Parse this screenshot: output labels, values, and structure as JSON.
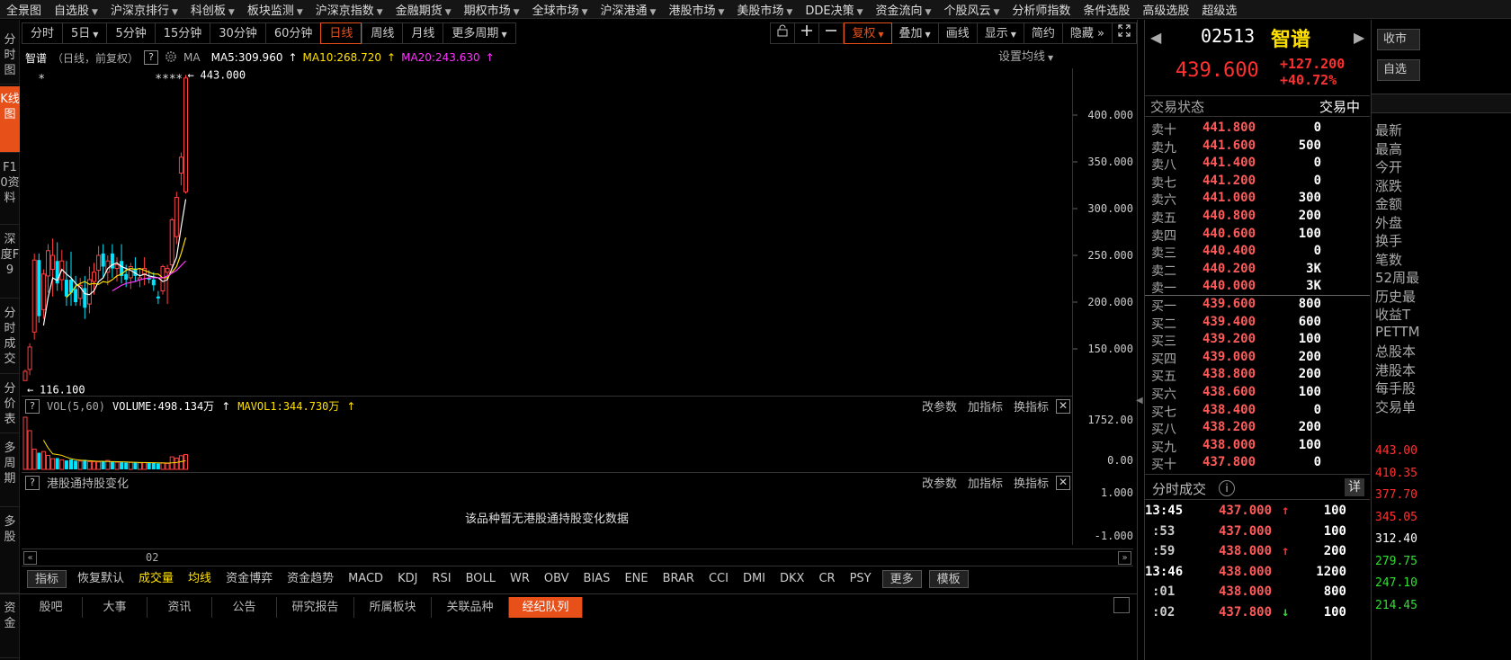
{
  "top_menu": {
    "items": [
      {
        "label": "全景图",
        "dropdown": false
      },
      {
        "label": "自选股",
        "dropdown": true
      },
      {
        "label": "沪深京排行",
        "dropdown": true
      },
      {
        "label": "科创板",
        "dropdown": true
      },
      {
        "label": "板块监测",
        "dropdown": true
      },
      {
        "label": "沪深京指数",
        "dropdown": true
      },
      {
        "label": "金融期货",
        "dropdown": true
      },
      {
        "label": "期权市场",
        "dropdown": true
      },
      {
        "label": "全球市场",
        "dropdown": true
      },
      {
        "label": "沪深港通",
        "dropdown": true
      },
      {
        "label": "港股市场",
        "dropdown": true
      },
      {
        "label": "美股市场",
        "dropdown": true
      },
      {
        "label": "DDE决策",
        "dropdown": true
      },
      {
        "label": "资金流向",
        "dropdown": true
      },
      {
        "label": "个股风云",
        "dropdown": true
      },
      {
        "label": "分析师指数",
        "dropdown": false
      },
      {
        "label": "条件选股",
        "dropdown": false
      },
      {
        "label": "高级选股",
        "dropdown": false
      },
      {
        "label": "超级选",
        "dropdown": false
      }
    ]
  },
  "sidebar": {
    "items": [
      {
        "label": "分时图",
        "active": false
      },
      {
        "label": "K线图",
        "active": true
      },
      {
        "label": "F10资料",
        "active": false
      },
      {
        "label": "深度F9",
        "active": false
      },
      {
        "label": "分时成交",
        "active": false
      },
      {
        "label": "分价表",
        "active": false
      },
      {
        "label": "多周期",
        "active": false
      },
      {
        "label": "多股",
        "active": false
      },
      {
        "label": "资金",
        "active": false
      }
    ]
  },
  "period_toolbar": {
    "buttons": [
      {
        "label": "分时",
        "active": false,
        "dropdown": false
      },
      {
        "label": "5日",
        "active": false,
        "dropdown": true
      },
      {
        "label": "5分钟",
        "active": false,
        "dropdown": false
      },
      {
        "label": "15分钟",
        "active": false,
        "dropdown": false
      },
      {
        "label": "30分钟",
        "active": false,
        "dropdown": false
      },
      {
        "label": "60分钟",
        "active": false,
        "dropdown": false
      },
      {
        "label": "日线",
        "active": true,
        "dropdown": false
      },
      {
        "label": "周线",
        "active": false,
        "dropdown": false
      },
      {
        "label": "月线",
        "active": false,
        "dropdown": false
      },
      {
        "label": "更多周期",
        "active": false,
        "dropdown": true
      }
    ],
    "right_buttons": [
      {
        "label": "复权",
        "active": true,
        "dropdown": true
      },
      {
        "label": "叠加",
        "active": false,
        "dropdown": true
      },
      {
        "label": "画线",
        "active": false,
        "dropdown": false
      },
      {
        "label": "显示",
        "active": false,
        "dropdown": true
      },
      {
        "label": "简约",
        "active": false,
        "dropdown": false
      },
      {
        "label": "隐藏",
        "active": false,
        "dropdown": false
      }
    ],
    "icons": [
      "lock-icon",
      "plus-icon",
      "minus-icon",
      "fullscreen-icon",
      "double-chevron-right-icon"
    ]
  },
  "kline_header": {
    "stock_name": "智谱",
    "mode": "（日线，前复权）",
    "ma_label": "MA",
    "ma5": "MA5:309.960",
    "ma10": "MA10:268.720",
    "ma20": "MA20:243.630",
    "settings": "设置均线",
    "ma5_color": "#ffffff",
    "ma10_color": "#ffe000",
    "ma20_color": "#ff33ff"
  },
  "kline_annotations": {
    "high": "443.000",
    "low": "116.100",
    "markers": [
      "*",
      "***",
      "*"
    ]
  },
  "chart_data": {
    "type": "candlestick",
    "x_tick": "02",
    "y_ticks": [
      "400.000",
      "350.000",
      "300.000",
      "250.000",
      "200.000",
      "150.000"
    ],
    "ylim": [
      100,
      450
    ],
    "candles": [
      {
        "o": 116.1,
        "h": 128,
        "l": 116.1,
        "c": 126
      },
      {
        "o": 128,
        "h": 156,
        "l": 122,
        "c": 152
      },
      {
        "o": 168,
        "h": 252,
        "l": 160,
        "c": 245
      },
      {
        "o": 245,
        "h": 252,
        "l": 178,
        "c": 185
      },
      {
        "o": 192,
        "h": 235,
        "l": 182,
        "c": 230
      },
      {
        "o": 228,
        "h": 262,
        "l": 210,
        "c": 255
      },
      {
        "o": 235,
        "h": 268,
        "l": 206,
        "c": 250
      },
      {
        "o": 244,
        "h": 264,
        "l": 212,
        "c": 220
      },
      {
        "o": 224,
        "h": 256,
        "l": 212,
        "c": 244
      },
      {
        "o": 224,
        "h": 244,
        "l": 196,
        "c": 206
      },
      {
        "o": 224,
        "h": 254,
        "l": 196,
        "c": 210
      },
      {
        "o": 214,
        "h": 228,
        "l": 196,
        "c": 200
      },
      {
        "o": 204,
        "h": 226,
        "l": 196,
        "c": 218
      },
      {
        "o": 215,
        "h": 228,
        "l": 182,
        "c": 194
      },
      {
        "o": 198,
        "h": 238,
        "l": 188,
        "c": 224
      },
      {
        "o": 222,
        "h": 242,
        "l": 208,
        "c": 232
      },
      {
        "o": 234,
        "h": 260,
        "l": 224,
        "c": 250
      },
      {
        "o": 252,
        "h": 262,
        "l": 226,
        "c": 238
      },
      {
        "o": 232,
        "h": 250,
        "l": 218,
        "c": 244
      },
      {
        "o": 252,
        "h": 262,
        "l": 226,
        "c": 236
      },
      {
        "o": 236,
        "h": 248,
        "l": 222,
        "c": 240
      },
      {
        "o": 244,
        "h": 262,
        "l": 220,
        "c": 228
      },
      {
        "o": 230,
        "h": 240,
        "l": 216,
        "c": 224
      },
      {
        "o": 226,
        "h": 242,
        "l": 214,
        "c": 238
      },
      {
        "o": 236,
        "h": 248,
        "l": 222,
        "c": 228
      },
      {
        "o": 224,
        "h": 236,
        "l": 216,
        "c": 226
      },
      {
        "o": 230,
        "h": 248,
        "l": 218,
        "c": 236
      },
      {
        "o": 226,
        "h": 234,
        "l": 220,
        "c": 224
      },
      {
        "o": 224,
        "h": 232,
        "l": 212,
        "c": 218
      },
      {
        "o": 206,
        "h": 212,
        "l": 198,
        "c": 204
      },
      {
        "o": 212,
        "h": 240,
        "l": 208,
        "c": 238
      },
      {
        "o": 232,
        "h": 240,
        "l": 198,
        "c": 236
      },
      {
        "o": 240,
        "h": 290,
        "l": 236,
        "c": 288
      },
      {
        "o": 270,
        "h": 318,
        "l": 262,
        "c": 312
      },
      {
        "o": 338,
        "h": 360,
        "l": 325,
        "c": 355
      },
      {
        "o": 318,
        "h": 443,
        "l": 316,
        "c": 439.6
      }
    ],
    "ma5": [
      null,
      null,
      null,
      null,
      175,
      205,
      226,
      223,
      235,
      230,
      226,
      220,
      216,
      209,
      208,
      212,
      222,
      226,
      236,
      240,
      242,
      238,
      236,
      234,
      231,
      228,
      230,
      228,
      227,
      226,
      222,
      224,
      236,
      248,
      280,
      310
    ],
    "ma10": [
      null,
      null,
      null,
      null,
      null,
      null,
      null,
      null,
      null,
      205,
      210,
      217,
      220,
      222,
      219,
      220,
      219,
      222,
      221,
      224,
      228,
      230,
      234,
      236,
      235,
      236,
      234,
      232,
      230,
      230,
      226,
      226,
      232,
      238,
      252,
      269
    ],
    "ma20": [
      null,
      null,
      null,
      null,
      null,
      null,
      null,
      null,
      null,
      null,
      null,
      null,
      null,
      null,
      null,
      null,
      null,
      null,
      null,
      212,
      215,
      218,
      220,
      221,
      222,
      224,
      225,
      226,
      226,
      226,
      226,
      228,
      231,
      234,
      239,
      244
    ]
  },
  "volume_panel": {
    "help": "?",
    "vol_label": "VOL(5,60)",
    "volume": "VOLUME:498.134万",
    "mavol": "MAVOL1:344.730万",
    "y_tick_top": "1752.00",
    "y_tick_bottom": "0.00",
    "btn_params": "改参数",
    "btn_add": "加指标",
    "btn_switch": "换指标",
    "bars": [
      1752,
      1300,
      680,
      560,
      600,
      470,
      360,
      380,
      320,
      300,
      330,
      290,
      280,
      320,
      260,
      260,
      250,
      260,
      300,
      260,
      240,
      240,
      230,
      230,
      230,
      220,
      230,
      220,
      220,
      200,
      220,
      200,
      420,
      380,
      460,
      498
    ],
    "bar_up": [
      true,
      true,
      true,
      false,
      true,
      true,
      true,
      false,
      true,
      false,
      false,
      false,
      true,
      false,
      true,
      true,
      true,
      false,
      true,
      false,
      true,
      false,
      false,
      true,
      false,
      true,
      true,
      false,
      false,
      false,
      true,
      true,
      true,
      true,
      true,
      true
    ],
    "mavol_line": [
      null,
      null,
      null,
      null,
      980,
      720,
      520,
      500,
      470,
      410,
      360,
      330,
      310,
      300,
      290,
      280,
      270,
      270,
      265,
      262,
      258,
      252,
      248,
      242,
      238,
      232,
      228,
      225,
      222,
      218,
      214,
      210,
      220,
      232,
      260,
      290
    ]
  },
  "hk_panel": {
    "help": "?",
    "title": "港股通持股变化",
    "empty_message": "该品种暂无港股通持股变化数据",
    "y_tick_top": "1.000",
    "y_tick_bottom": "-1.000",
    "btn_params": "改参数",
    "btn_add": "加指标",
    "btn_switch": "换指标"
  },
  "indicator_tabs": {
    "items": [
      {
        "label": "指标",
        "style": "box"
      },
      {
        "label": "恢复默认",
        "style": ""
      },
      {
        "label": "成交量",
        "style": "hl"
      },
      {
        "label": "均线",
        "style": "hl"
      },
      {
        "label": "资金博弈",
        "style": ""
      },
      {
        "label": "资金趋势",
        "style": ""
      },
      {
        "label": "MACD",
        "style": ""
      },
      {
        "label": "KDJ",
        "style": ""
      },
      {
        "label": "RSI",
        "style": ""
      },
      {
        "label": "BOLL",
        "style": ""
      },
      {
        "label": "WR",
        "style": ""
      },
      {
        "label": "OBV",
        "style": ""
      },
      {
        "label": "BIAS",
        "style": ""
      },
      {
        "label": "ENE",
        "style": ""
      },
      {
        "label": "BRAR",
        "style": ""
      },
      {
        "label": "CCI",
        "style": ""
      },
      {
        "label": "DMI",
        "style": ""
      },
      {
        "label": "DKX",
        "style": ""
      },
      {
        "label": "CR",
        "style": ""
      },
      {
        "label": "PSY",
        "style": ""
      },
      {
        "label": "更多",
        "style": "box"
      },
      {
        "label": "模板",
        "style": "box"
      }
    ]
  },
  "bottom_tabs": {
    "items": [
      {
        "label": "股吧",
        "active": false
      },
      {
        "label": "大事",
        "active": false
      },
      {
        "label": "资讯",
        "active": false
      },
      {
        "label": "公告",
        "active": false
      },
      {
        "label": "研究报告",
        "active": false
      },
      {
        "label": "所属板块",
        "active": false
      },
      {
        "label": "关联品种",
        "active": false
      },
      {
        "label": "经纪队列",
        "active": true
      }
    ]
  },
  "quote": {
    "code": "02513",
    "name": "智谱",
    "price": "439.600",
    "change": "+127.200",
    "change_pct": "+40.72%",
    "status_label": "交易状态",
    "status_value": "交易中",
    "up_color": "#ff3030"
  },
  "order_book": {
    "asks": [
      {
        "label": "卖十",
        "price": "441.800",
        "vol": "0"
      },
      {
        "label": "卖九",
        "price": "441.600",
        "vol": "500"
      },
      {
        "label": "卖八",
        "price": "441.400",
        "vol": "0"
      },
      {
        "label": "卖七",
        "price": "441.200",
        "vol": "0"
      },
      {
        "label": "卖六",
        "price": "441.000",
        "vol": "300"
      },
      {
        "label": "卖五",
        "price": "440.800",
        "vol": "200"
      },
      {
        "label": "卖四",
        "price": "440.600",
        "vol": "100"
      },
      {
        "label": "卖三",
        "price": "440.400",
        "vol": "0"
      },
      {
        "label": "卖二",
        "price": "440.200",
        "vol": "3K"
      },
      {
        "label": "卖一",
        "price": "440.000",
        "vol": "3K"
      }
    ],
    "bids": [
      {
        "label": "买一",
        "price": "439.600",
        "vol": "800"
      },
      {
        "label": "买二",
        "price": "439.400",
        "vol": "600"
      },
      {
        "label": "买三",
        "price": "439.200",
        "vol": "100"
      },
      {
        "label": "买四",
        "price": "439.000",
        "vol": "200"
      },
      {
        "label": "买五",
        "price": "438.800",
        "vol": "200"
      },
      {
        "label": "买六",
        "price": "438.600",
        "vol": "100"
      },
      {
        "label": "买七",
        "price": "438.400",
        "vol": "0"
      },
      {
        "label": "买八",
        "price": "438.200",
        "vol": "200"
      },
      {
        "label": "买九",
        "price": "438.000",
        "vol": "100"
      },
      {
        "label": "买十",
        "price": "437.800",
        "vol": "0"
      }
    ]
  },
  "ticks": {
    "title": "分时成交",
    "detail": "详",
    "rows": [
      {
        "time": "13:45",
        "price": "437.000",
        "arrow": "up",
        "vol": "100",
        "bold_time": true
      },
      {
        "time": ":53",
        "price": "437.000",
        "arrow": "",
        "vol": "100",
        "bold_time": false
      },
      {
        "time": ":59",
        "price": "438.000",
        "arrow": "up",
        "vol": "200",
        "bold_time": false
      },
      {
        "time": "13:46",
        "price": "438.000",
        "arrow": "",
        "vol": "1200",
        "bold_time": true
      },
      {
        "time": ":01",
        "price": "438.000",
        "arrow": "",
        "vol": "800",
        "bold_time": false
      },
      {
        "time": ":02",
        "price": "437.800",
        "arrow": "down",
        "vol": "100",
        "bold_time": false
      }
    ]
  },
  "far_right": {
    "tab1": "收市",
    "tab2": "自选",
    "labels": [
      "最新",
      "最高",
      "今开",
      "涨跌",
      "金额",
      "外盘",
      "换手",
      "笔数",
      "52周最",
      "历史最",
      "收益T",
      "PETTM",
      "总股本",
      "港股本",
      "每手股",
      "交易单"
    ],
    "price_ticks": [
      "443.00",
      "410.35",
      "377.70",
      "345.05",
      "312.40",
      "279.75",
      "247.10",
      "214.45"
    ],
    "price_tick_colors": [
      "#ff3030",
      "#ff3030",
      "#ff3030",
      "#ff3030",
      "#ffffff",
      "#33dd33",
      "#33dd33",
      "#33dd33"
    ]
  }
}
